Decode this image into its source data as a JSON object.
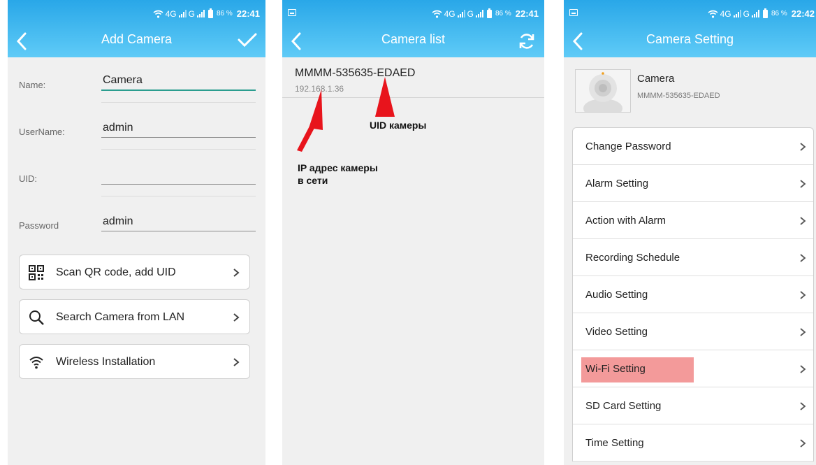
{
  "status_bars": [
    {
      "network": "4G",
      "network2": "G",
      "battery": "86 %",
      "time": "22:41"
    },
    {
      "network": "4G",
      "network2": "G",
      "battery": "86 %",
      "time": "22:41"
    },
    {
      "network": "4G",
      "network2": "G",
      "battery": "86 %",
      "time": "22:42"
    }
  ],
  "add_camera": {
    "title": "Add Camera",
    "fields": [
      {
        "label": "Name:",
        "value": "Camera"
      },
      {
        "label": "UserName:",
        "value": "admin"
      },
      {
        "label": "UID:",
        "value": ""
      },
      {
        "label": "Password",
        "value": "admin"
      }
    ],
    "actions": [
      {
        "label": "Scan QR code, add UID",
        "icon": "qr-code-icon"
      },
      {
        "label": "Search Camera from LAN",
        "icon": "search-icon"
      },
      {
        "label": "Wireless Installation",
        "icon": "wifi-icon"
      }
    ]
  },
  "camera_list": {
    "title": "Camera list",
    "items": [
      {
        "uid": "MMMM-535635-EDAED",
        "ip": "192.168.1.36"
      }
    ],
    "annotations": {
      "uid_note": "UID камеры",
      "ip_note_line1": "IP адрес камеры",
      "ip_note_line2": "в сети"
    }
  },
  "camera_setting": {
    "title": "Camera Setting",
    "camera_name": "Camera",
    "camera_uid": "MMMM-535635-EDAED",
    "menu": [
      "Change Password",
      "Alarm Setting",
      "Action with Alarm",
      "Recording Schedule",
      "Audio Setting",
      "Video Setting",
      "Wi-Fi Setting",
      "SD Card Setting",
      "Time Setting"
    ],
    "highlight_color": "#f39a9a"
  },
  "colors": {
    "accent": "#29a7e8",
    "focus_underline": "#2a9d8f",
    "annotation_arrow": "#e8141c"
  }
}
